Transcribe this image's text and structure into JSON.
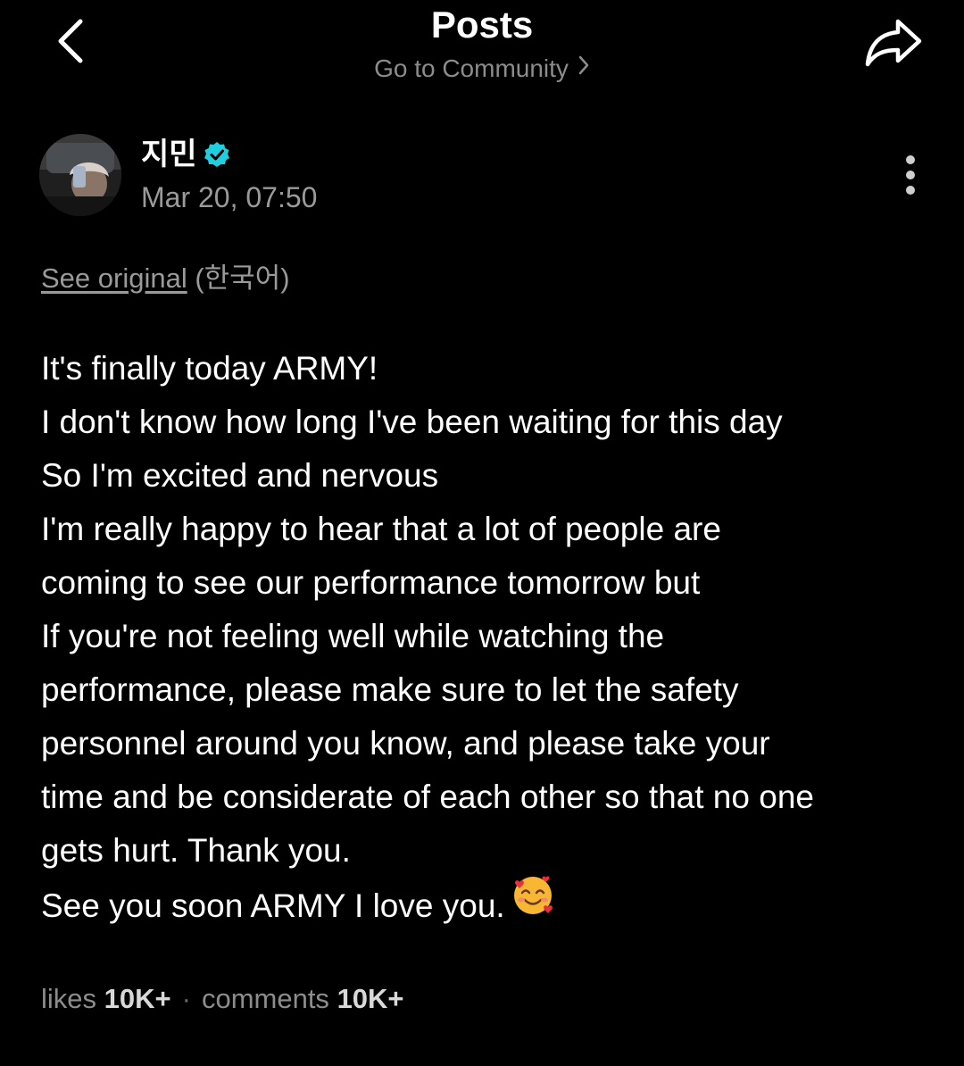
{
  "header": {
    "title": "Posts",
    "community_link": "Go to Community",
    "back_icon": "chevron-left-icon",
    "share_icon": "share-arrow-icon"
  },
  "author": {
    "name": "지민",
    "verified": true,
    "verified_color": "#1ecfe0",
    "timestamp": "Mar 20, 07:50"
  },
  "translation": {
    "see_original": "See original",
    "language": "(한국어)"
  },
  "post": {
    "lines": [
      "It's finally today ARMY!",
      "I don't know how long I've been waiting for this day",
      "So I'm excited and nervous",
      "I'm really happy to hear that a lot of people are",
      "coming to see our performance tomorrow but",
      "If you're not feeling well while watching the",
      "performance, please make sure to let the safety",
      "personnel around you know, and please take your",
      "time and be considerate of each other so that no one",
      "gets hurt. Thank you.",
      "See you soon ARMY I love you."
    ],
    "emoji": "smiling-face-with-hearts-icon"
  },
  "stats": {
    "likes_label": "likes",
    "likes_count": "10K+",
    "separator": "·",
    "comments_label": "comments",
    "comments_count": "10K+"
  },
  "colors": {
    "background": "#000000",
    "text": "#ffffff",
    "muted": "#9a9a9a",
    "verified": "#1ecfe0"
  }
}
